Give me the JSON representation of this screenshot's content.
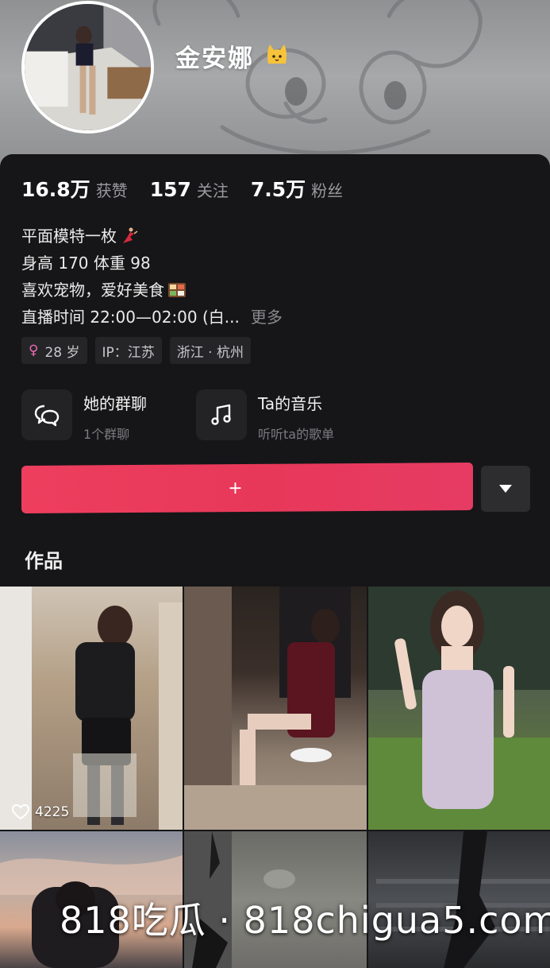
{
  "profile": {
    "nickname": "金安娜",
    "nickname_emoji": "cat-face-icon"
  },
  "stats": [
    {
      "value": "16.8万",
      "label": "获赞"
    },
    {
      "value": "157",
      "label": "关注"
    },
    {
      "value": "7.5万",
      "label": "粉丝"
    }
  ],
  "bio": {
    "line1": "平面模特一枚",
    "line2": "身高 170 体重 98",
    "line3": "喜欢宠物，爱好美食",
    "line4": "直播时间 22:00—02:00 (白...",
    "more": "更多"
  },
  "tags": {
    "age": "28 岁",
    "ip": "IP：江苏",
    "location": "浙江 · 杭州"
  },
  "cards": {
    "group": {
      "title": "她的群聊",
      "subtitle": "1个群聊"
    },
    "music": {
      "title": "Ta的音乐",
      "subtitle": "听听ta的歌单"
    }
  },
  "actions": {
    "follow": "+ ",
    "follow_color": "#e93b5e"
  },
  "works": {
    "title": "作品",
    "items": [
      {
        "likes": "4225"
      },
      {
        "likes": ""
      },
      {
        "likes": ""
      },
      {
        "likes": ""
      },
      {
        "likes": ""
      },
      {
        "likes": ""
      }
    ]
  },
  "watermark": "818吃瓜 · 818chigua5.com",
  "colors": {
    "background": "#161618",
    "accent": "#e93b5e",
    "muted_text": "#9a9a9e"
  }
}
